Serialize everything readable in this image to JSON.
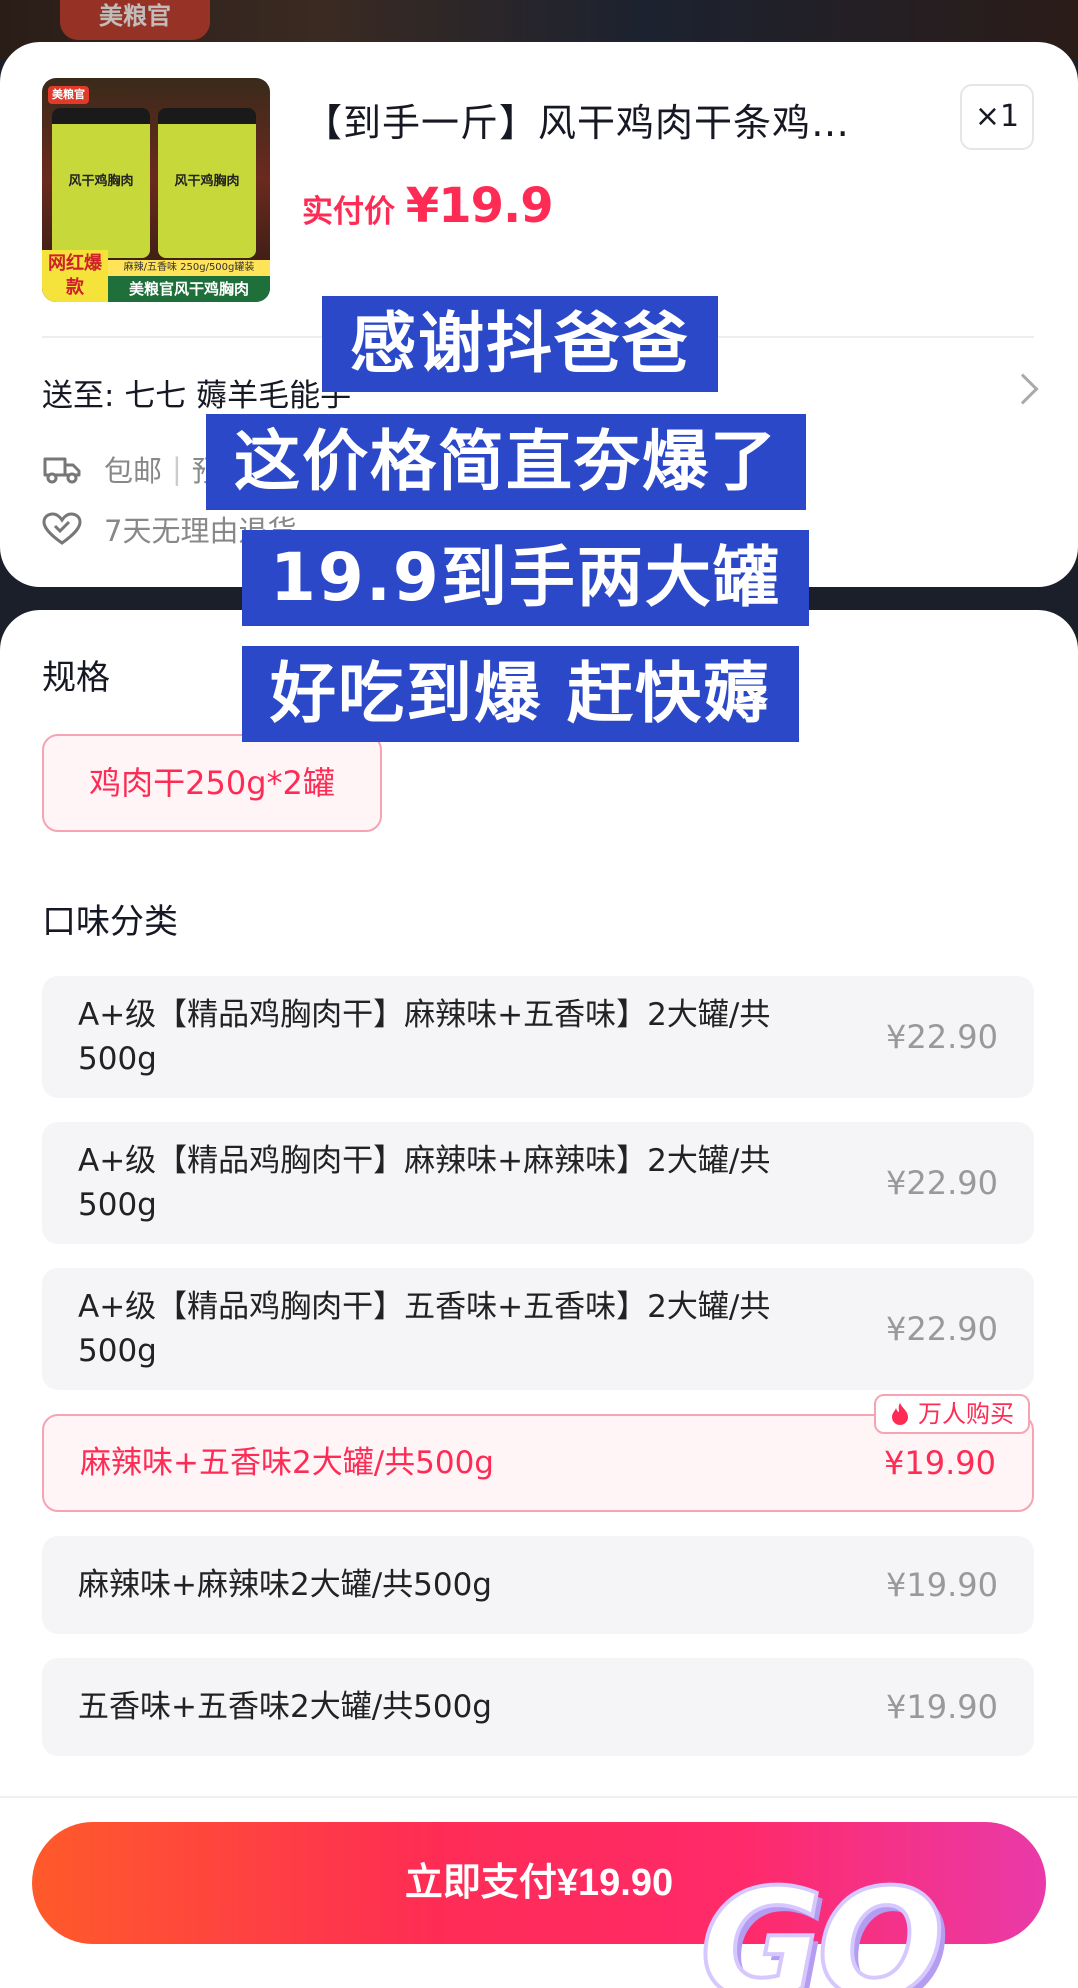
{
  "background": {
    "label": "美粮官"
  },
  "product": {
    "title": "【到手一斤】风干鸡肉干条鸡…",
    "quantity": "×1",
    "price_label": "实付价 ",
    "price_value": "¥19.9",
    "image": {
      "brand_tag": "美粮官",
      "jar_text": "风干鸡胸肉",
      "hot_badge": "网红爆款",
      "flavor_strip": "麻辣/五香味 250g/500g罐装",
      "bottom_strip": "美粮官风干鸡胸肉"
    }
  },
  "delivery": {
    "ship_to_prefix": "送至:",
    "ship_to_value": "七七  薅羊毛能手",
    "service_1": "包邮",
    "service_1_sep": "|",
    "service_1_more": "预",
    "service_2": "7天无理由退货"
  },
  "spec": {
    "title": "规格",
    "selected": "鸡肉干250g*2罐"
  },
  "flavor": {
    "title": "口味分类",
    "options": [
      {
        "label": "A+级【精品鸡胸肉干】麻辣味+五香味】2大罐/共500g",
        "price": "¥22.90"
      },
      {
        "label": "A+级【精品鸡胸肉干】麻辣味+麻辣味】2大罐/共500g",
        "price": "¥22.90"
      },
      {
        "label": "A+级【精品鸡胸肉干】五香味+五香味】2大罐/共500g",
        "price": "¥22.90"
      },
      {
        "label": "麻辣味+五香味2大罐/共500g",
        "price": "¥19.90"
      },
      {
        "label": "麻辣味+麻辣味2大罐/共500g",
        "price": "¥19.90"
      },
      {
        "label": "五香味+五香味2大罐/共500g",
        "price": "¥19.90"
      }
    ],
    "hot_tag": "万人购买"
  },
  "footer": {
    "pay_label": "立即支付¥19.90",
    "go_text": "GO"
  },
  "captions": [
    "感谢抖爸爸",
    "这价格简直夯爆了",
    "19.9到手两大罐",
    "好吃到爆 赶快薅"
  ],
  "colors": {
    "accent": "#fe2c55",
    "caption_bg": "#2b48c8",
    "option_bg": "#f5f5f8"
  }
}
